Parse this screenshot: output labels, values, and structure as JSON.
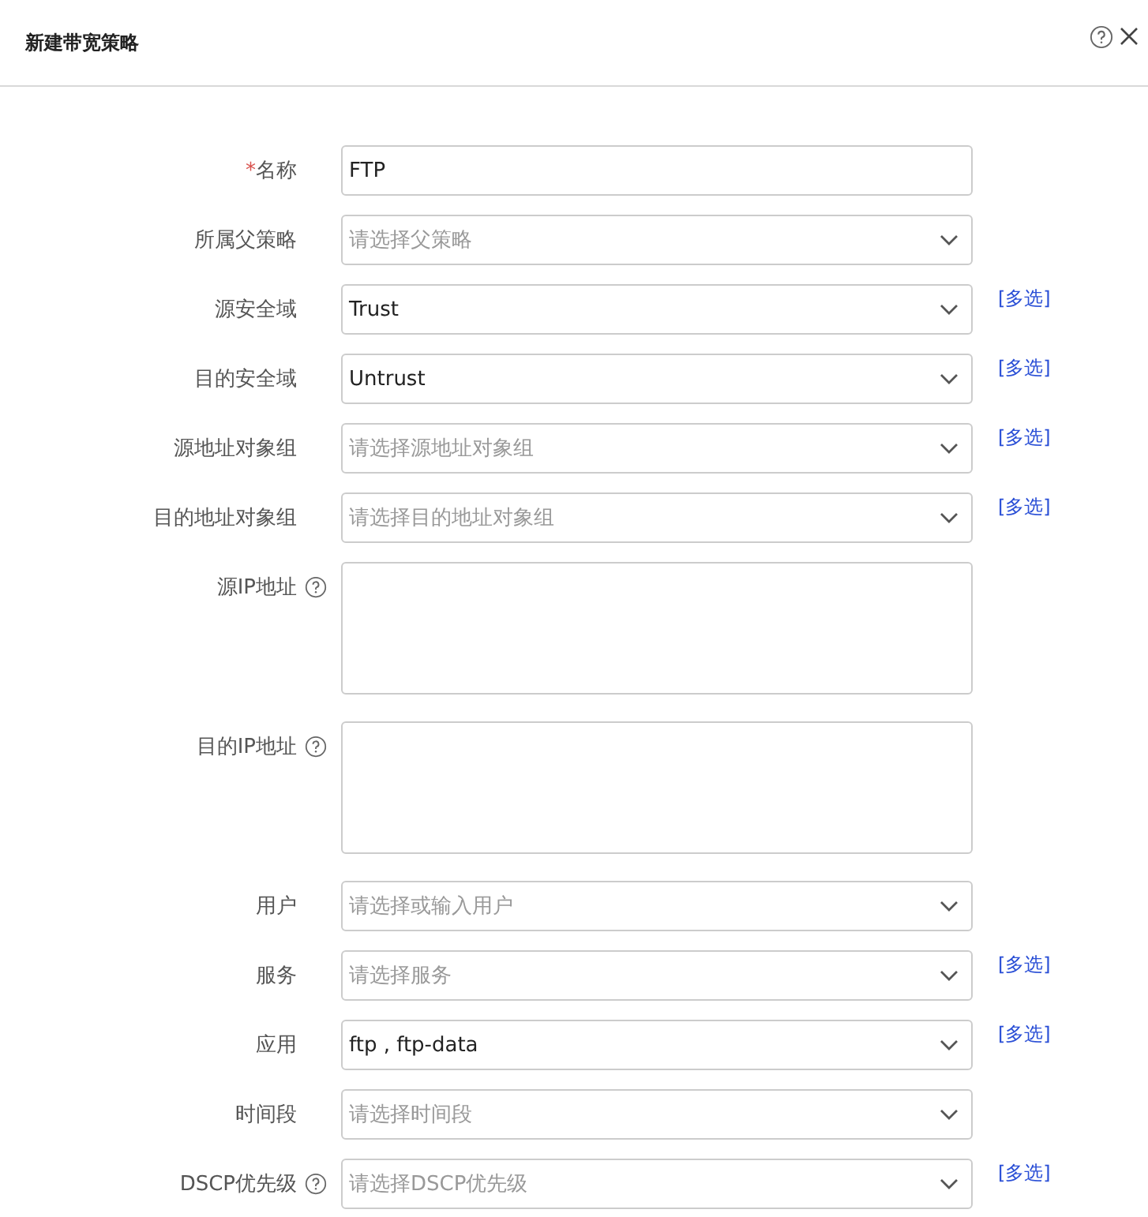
{
  "dialog": {
    "title": "新建带宽策略"
  },
  "fields": [
    {
      "label": "名称",
      "required_mark": "*",
      "kind": "input",
      "value": "FTP",
      "help": false
    },
    {
      "label": "所属父策略",
      "kind": "select",
      "placeholder": "请选择父策略",
      "help": false
    },
    {
      "label": "源安全域",
      "kind": "select",
      "value": "Trust",
      "help": false,
      "link": "[多选]"
    },
    {
      "label": "目的安全域",
      "kind": "select",
      "value": "Untrust",
      "help": false,
      "link": "[多选]"
    },
    {
      "label": "源地址对象组",
      "kind": "select",
      "placeholder": "请选择源地址对象组",
      "help": false,
      "link": "[多选]"
    },
    {
      "label": "目的地址对象组",
      "kind": "select",
      "placeholder": "请选择目的地址对象组",
      "help": false,
      "link": "[多选]"
    },
    {
      "label": "源IP地址",
      "kind": "textarea",
      "help": true
    },
    {
      "label": "目的IP地址",
      "kind": "textarea",
      "help": true
    },
    {
      "label": "用户",
      "kind": "select",
      "placeholder": "请选择或输入用户",
      "help": false
    },
    {
      "label": "服务",
      "kind": "select",
      "placeholder": "请选择服务",
      "help": false,
      "link": "[多选]"
    },
    {
      "label": "应用",
      "kind": "select",
      "value": "ftp , ftp-data",
      "help": false,
      "link": "[多选]"
    },
    {
      "label": "时间段",
      "kind": "select",
      "placeholder": "请选择时间段",
      "help": false
    },
    {
      "label": "DSCP优先级",
      "kind": "select",
      "placeholder": "请选择DSCP优先级",
      "help": true,
      "link": "[多选]"
    }
  ]
}
